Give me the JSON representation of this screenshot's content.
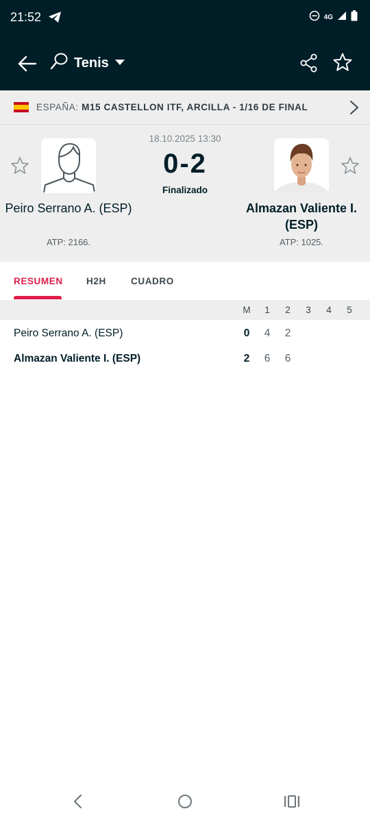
{
  "status_bar": {
    "time": "21:52",
    "network": "4G"
  },
  "app_bar": {
    "sport_label": "Tenis"
  },
  "tournament": {
    "country": "ESPAÑA:",
    "name": "M15 CASTELLON ITF, ARCILLA - 1/16 DE FINAL"
  },
  "match": {
    "date": "18.10.2025 13:30",
    "score": "0-2",
    "status": "Finalizado",
    "home": {
      "name": "Peiro Serrano A. (ESP)",
      "rank": "ATP: 2166."
    },
    "away": {
      "name": "Almazan Valiente I. (ESP)",
      "rank": "ATP: 1025."
    }
  },
  "tabs": [
    {
      "label": "RESUMEN",
      "active": true
    },
    {
      "label": "H2H",
      "active": false
    },
    {
      "label": "CUADRO",
      "active": false
    }
  ],
  "scoreboard": {
    "columns": [
      "M",
      "1",
      "2",
      "3",
      "4",
      "5"
    ],
    "rows": [
      {
        "player": "Peiro Serrano A. (ESP)",
        "sets_won": "0",
        "sets": [
          "4",
          "2",
          "",
          "",
          ""
        ],
        "winner": false
      },
      {
        "player": "Almazan Valiente I. (ESP)",
        "sets_won": "2",
        "sets": [
          "6",
          "6",
          "",
          "",
          ""
        ],
        "winner": true
      }
    ]
  },
  "colors": {
    "header_bg": "#001e28",
    "panel_bg": "#eeeeee",
    "accent": "#df1e4a"
  }
}
